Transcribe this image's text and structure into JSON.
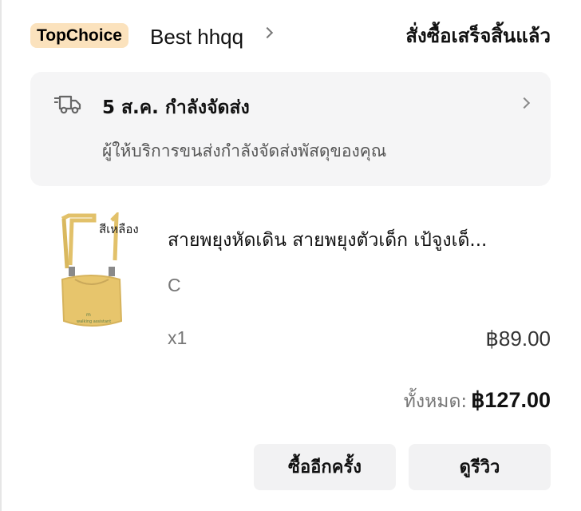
{
  "header": {
    "badge": "TopChoice",
    "shop_name": "Best hhqq",
    "order_status": "สั่งซื้อเสร็จสิ้นแล้ว"
  },
  "delivery": {
    "icon": "truck-icon",
    "title": "5 ส.ค. กำลังจัดส่ง",
    "subtitle": "ผู้ให้บริการขนส่งกำลังจัดส่งพัสดุของคุณ"
  },
  "product": {
    "thumbnail_label": "สีเหลือง",
    "title": "สายพยุงหัดเดิน สายพยุงตัวเด็ก เป้จูงเด็...",
    "variant": "C",
    "quantity": "x1",
    "price": "฿89.00"
  },
  "summary": {
    "total_label": "ทั้งหมด:",
    "total_value": "฿127.00"
  },
  "actions": {
    "buy_again": "ซื้ออีกครั้ง",
    "review": "ดูรีวิว"
  },
  "colors": {
    "badge_bg": "#fbe2bd",
    "panel_bg": "#f5f5f6",
    "button_bg": "#f2f2f3",
    "product_yellow": "#e5c66e"
  }
}
